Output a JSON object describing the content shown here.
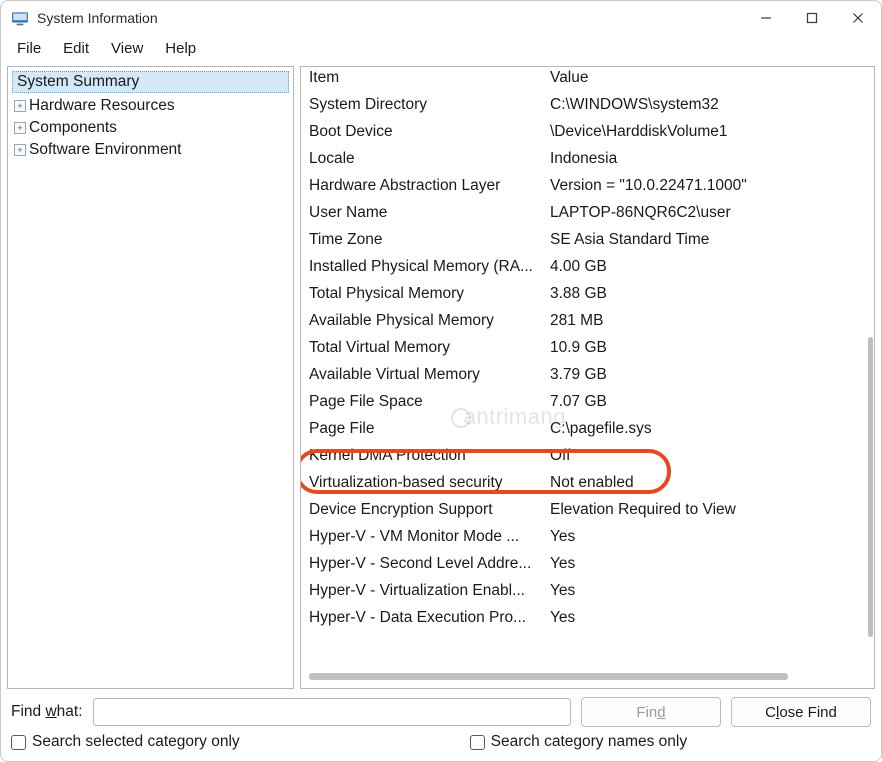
{
  "window": {
    "title": "System Information"
  },
  "menu": {
    "file": "File",
    "edit": "Edit",
    "view": "View",
    "help": "Help"
  },
  "tree": {
    "root": "System Summary",
    "nodes": [
      "Hardware Resources",
      "Components",
      "Software Environment"
    ]
  },
  "columns": {
    "item": "Item",
    "value": "Value"
  },
  "rows": [
    {
      "item": "System Directory",
      "value": "C:\\WINDOWS\\system32"
    },
    {
      "item": "Boot Device",
      "value": "\\Device\\HarddiskVolume1"
    },
    {
      "item": "Locale",
      "value": "Indonesia"
    },
    {
      "item": "Hardware Abstraction Layer",
      "value": "Version = \"10.0.22471.1000\""
    },
    {
      "item": "User Name",
      "value": "LAPTOP-86NQR6C2\\user"
    },
    {
      "item": "Time Zone",
      "value": "SE Asia Standard Time"
    },
    {
      "item": "Installed Physical Memory (RA...",
      "value": "4.00 GB"
    },
    {
      "item": "Total Physical Memory",
      "value": "3.88 GB"
    },
    {
      "item": "Available Physical Memory",
      "value": "281 MB"
    },
    {
      "item": "Total Virtual Memory",
      "value": "10.9 GB"
    },
    {
      "item": "Available Virtual Memory",
      "value": "3.79 GB"
    },
    {
      "item": "Page File Space",
      "value": "7.07 GB"
    },
    {
      "item": "Page File",
      "value": "C:\\pagefile.sys"
    },
    {
      "item": "Kernel DMA Protection",
      "value": "Off"
    },
    {
      "item": "Virtualization-based security",
      "value": "Not enabled"
    },
    {
      "item": "Device Encryption Support",
      "value": "Elevation Required to View"
    },
    {
      "item": "Hyper-V - VM Monitor Mode ...",
      "value": "Yes"
    },
    {
      "item": "Hyper-V - Second Level Addre...",
      "value": "Yes"
    },
    {
      "item": "Hyper-V - Virtualization Enabl...",
      "value": "Yes"
    },
    {
      "item": "Hyper-V - Data Execution Pro...",
      "value": "Yes"
    }
  ],
  "highlight_row_index": 14,
  "watermark": "antrimang",
  "find": {
    "label_prefix": "Find ",
    "label_underline": "w",
    "label_suffix": "hat:",
    "value": "",
    "find_btn_prefix": "Fin",
    "find_btn_underline": "d",
    "close_btn_prefix": "C",
    "close_btn_underline": "l",
    "close_btn_suffix": "ose Find",
    "chk1_prefix": "",
    "chk1_underline": "S",
    "chk1_suffix": "earch selected category only",
    "chk2_prefix": "Search ",
    "chk2_underline": "c",
    "chk2_suffix": "ategory names only"
  }
}
